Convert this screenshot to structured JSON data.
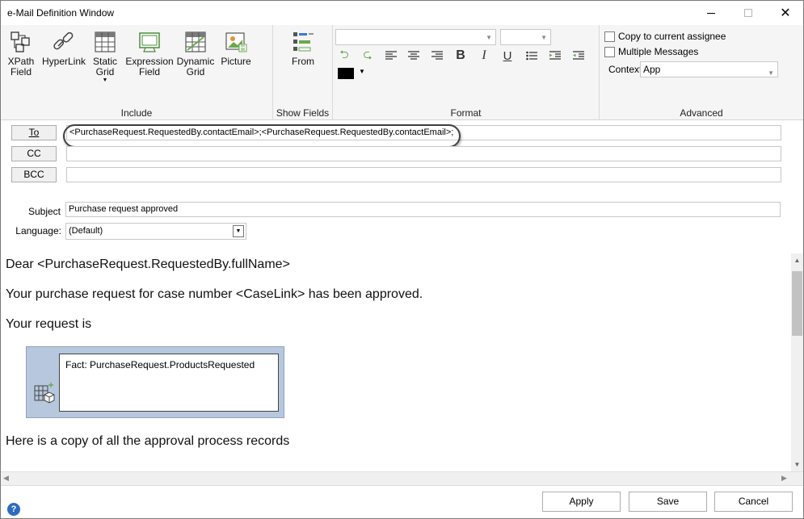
{
  "window": {
    "title": "e-Mail Definition Window"
  },
  "ribbon": {
    "include": {
      "label": "Include",
      "buttons": [
        {
          "line1": "XPath",
          "line2": "Field"
        },
        {
          "line1": "HyperLink",
          "line2": ""
        },
        {
          "line1": "Static",
          "line2": "Grid"
        },
        {
          "line1": "Expression",
          "line2": "Field"
        },
        {
          "line1": "Dynamic",
          "line2": "Grid"
        },
        {
          "line1": "Picture",
          "line2": ""
        }
      ]
    },
    "show_fields": {
      "label": "Show Fields",
      "from_label": "From"
    },
    "format": {
      "label": "Format",
      "font_value": "",
      "size_value": "",
      "text_color": "#000000"
    },
    "advanced": {
      "label": "Advanced",
      "copy_assignee_label": "Copy to current assignee",
      "multiple_messages_label": "Multiple Messages",
      "context_label": "Context",
      "context_value": "App"
    }
  },
  "address": {
    "to_label": "To",
    "to_value": "<PurchaseRequest.RequestedBy.contactEmail>;<PurchaseRequest.RequestedBy.contactEmail>;",
    "cc_label": "CC",
    "cc_value": "",
    "bcc_label": "BCC",
    "bcc_value": "",
    "subject_label": "Subject",
    "subject_value": "Purchase request approved",
    "language_label": "Language:",
    "language_value": "(Default)"
  },
  "body": {
    "line1": "Dear <PurchaseRequest.RequestedBy.fullName>",
    "line2": "Your purchase request for case number <CaseLink> has been approved.",
    "line3": "Your request is",
    "fact_text": "Fact: PurchaseRequest.ProductsRequested",
    "line4": "Here is a copy of all the approval process records"
  },
  "footer": {
    "apply": "Apply",
    "save": "Save",
    "cancel": "Cancel",
    "help": "?"
  }
}
